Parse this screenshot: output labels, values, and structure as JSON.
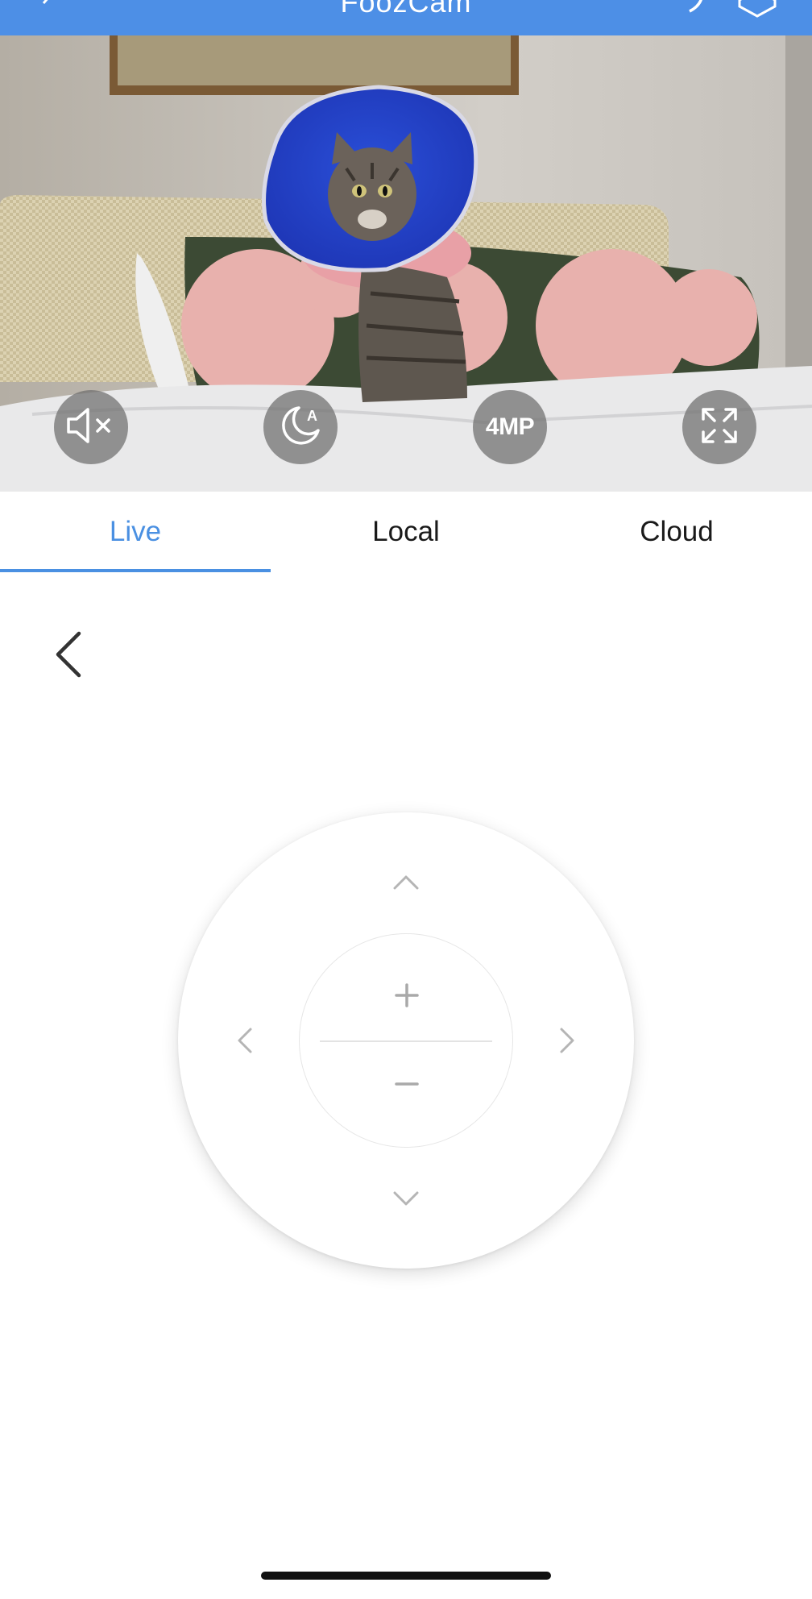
{
  "app": {
    "title": "FoozCam"
  },
  "video_controls": {
    "mute": "mute-icon",
    "night_mode": "night-mode-auto-icon",
    "resolution_label": "4MP",
    "fullscreen": "fullscreen-icon"
  },
  "tabs": [
    {
      "label": "Live",
      "active": true
    },
    {
      "label": "Local",
      "active": false
    },
    {
      "label": "Cloud",
      "active": false
    }
  ],
  "ptz": {
    "up": "chevron-up-icon",
    "down": "chevron-down-icon",
    "left": "chevron-left-icon",
    "right": "chevron-right-icon",
    "zoom_in": "plus-icon",
    "zoom_out": "minus-icon"
  },
  "colors": {
    "accent": "#4a90e2",
    "topbar": "#4d8fe6"
  }
}
